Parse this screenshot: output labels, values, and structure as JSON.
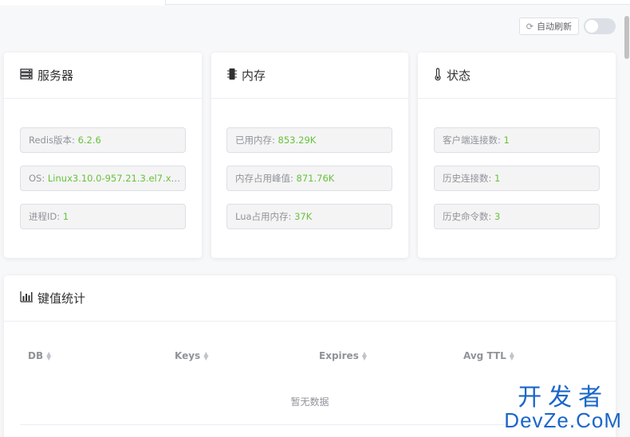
{
  "toolbar": {
    "refresh_label": "自动刷新",
    "refresh_icon": "refresh-icon",
    "auto_refresh_on": false
  },
  "cards": {
    "server": {
      "title": "服务器",
      "icon": "server-icon",
      "items": [
        {
          "label": "Redis版本: ",
          "value": "6.2.6"
        },
        {
          "label": "OS: ",
          "value": "Linux3.10.0-957.21.3.el7.x86_..."
        },
        {
          "label": "进程ID: ",
          "value": "1"
        }
      ]
    },
    "memory": {
      "title": "内存",
      "icon": "memory-icon",
      "items": [
        {
          "label": "已用内存: ",
          "value": "853.29K"
        },
        {
          "label": "内存占用峰值: ",
          "value": "871.76K"
        },
        {
          "label": "Lua占用内存: ",
          "value": "37K"
        }
      ]
    },
    "status": {
      "title": "状态",
      "icon": "thermometer-icon",
      "items": [
        {
          "label": "客户端连接数: ",
          "value": "1"
        },
        {
          "label": "历史连接数: ",
          "value": "1"
        },
        {
          "label": "历史命令数: ",
          "value": "3"
        }
      ]
    }
  },
  "key_stats": {
    "title": "键值统计",
    "icon": "bar-chart-icon",
    "columns": [
      "DB",
      "Keys",
      "Expires",
      "Avg TTL"
    ],
    "empty_text": "暂无数据"
  },
  "watermark": {
    "line1": "开发者",
    "line2": "DevZe.CoM"
  },
  "colors": {
    "value_green": "#67c23a",
    "label_gray": "#909399"
  }
}
